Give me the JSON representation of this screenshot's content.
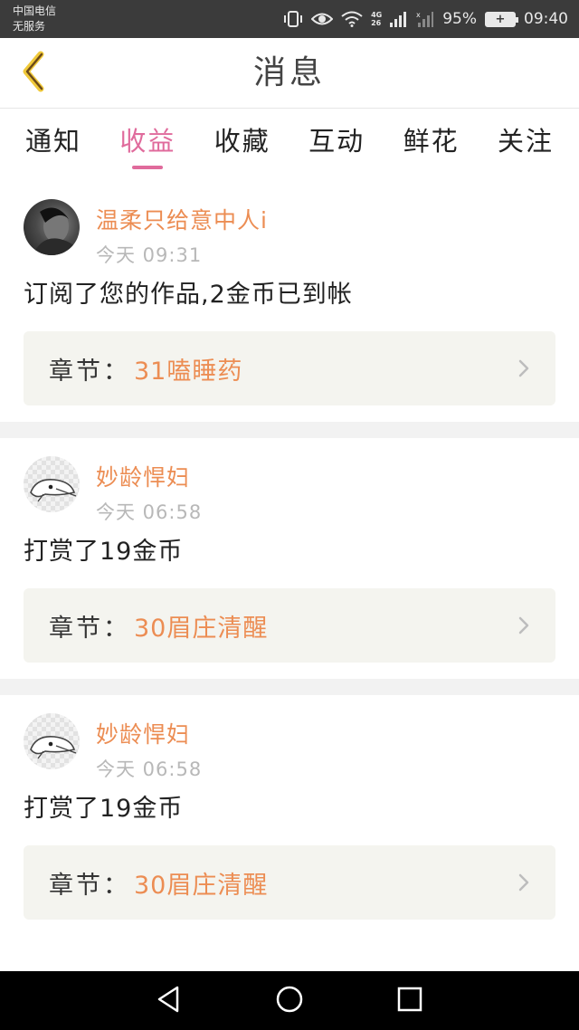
{
  "status_bar": {
    "carrier_line1": "中国电信",
    "carrier_line2": "无服务",
    "network_label_top": "4G",
    "network_label_bottom": "26",
    "battery_percent": "95%",
    "time": "09:40",
    "icons": [
      "vibrate-icon",
      "eye-icon",
      "wifi-icon",
      "signal-icon",
      "signal-empty-icon",
      "battery-icon"
    ]
  },
  "header": {
    "title": "消息",
    "back_icon": "chevron-left-icon"
  },
  "tabs": [
    {
      "label": "通知",
      "active": false
    },
    {
      "label": "收益",
      "active": true
    },
    {
      "label": "收藏",
      "active": false
    },
    {
      "label": "互动",
      "active": false
    },
    {
      "label": "鲜花",
      "active": false
    },
    {
      "label": "关注",
      "active": false
    }
  ],
  "colors": {
    "accent_pink": "#e06b9c",
    "username_orange": "#ec8d53",
    "chapter_bg": "#f4f4ef"
  },
  "messages": [
    {
      "username": "温柔只给意中人i",
      "avatar": "photo-avatar",
      "time": "今天 09:31",
      "text": "订阅了您的作品,2金币已到帐",
      "chapter_label": "章节：",
      "chapter_name": "31嗑睡药"
    },
    {
      "username": "妙龄悍妇",
      "avatar": "cartoon-avatar",
      "time": "今天 06:58",
      "text": "打赏了19金币",
      "chapter_label": "章节：",
      "chapter_name": "30眉庄清醒"
    },
    {
      "username": "妙龄悍妇",
      "avatar": "cartoon-avatar",
      "time": "今天 06:58",
      "text": "打赏了19金币",
      "chapter_label": "章节：",
      "chapter_name": "30眉庄清醒"
    }
  ],
  "nav_bar": {
    "buttons": [
      "back-triangle-icon",
      "home-circle-icon",
      "recents-square-icon"
    ]
  }
}
